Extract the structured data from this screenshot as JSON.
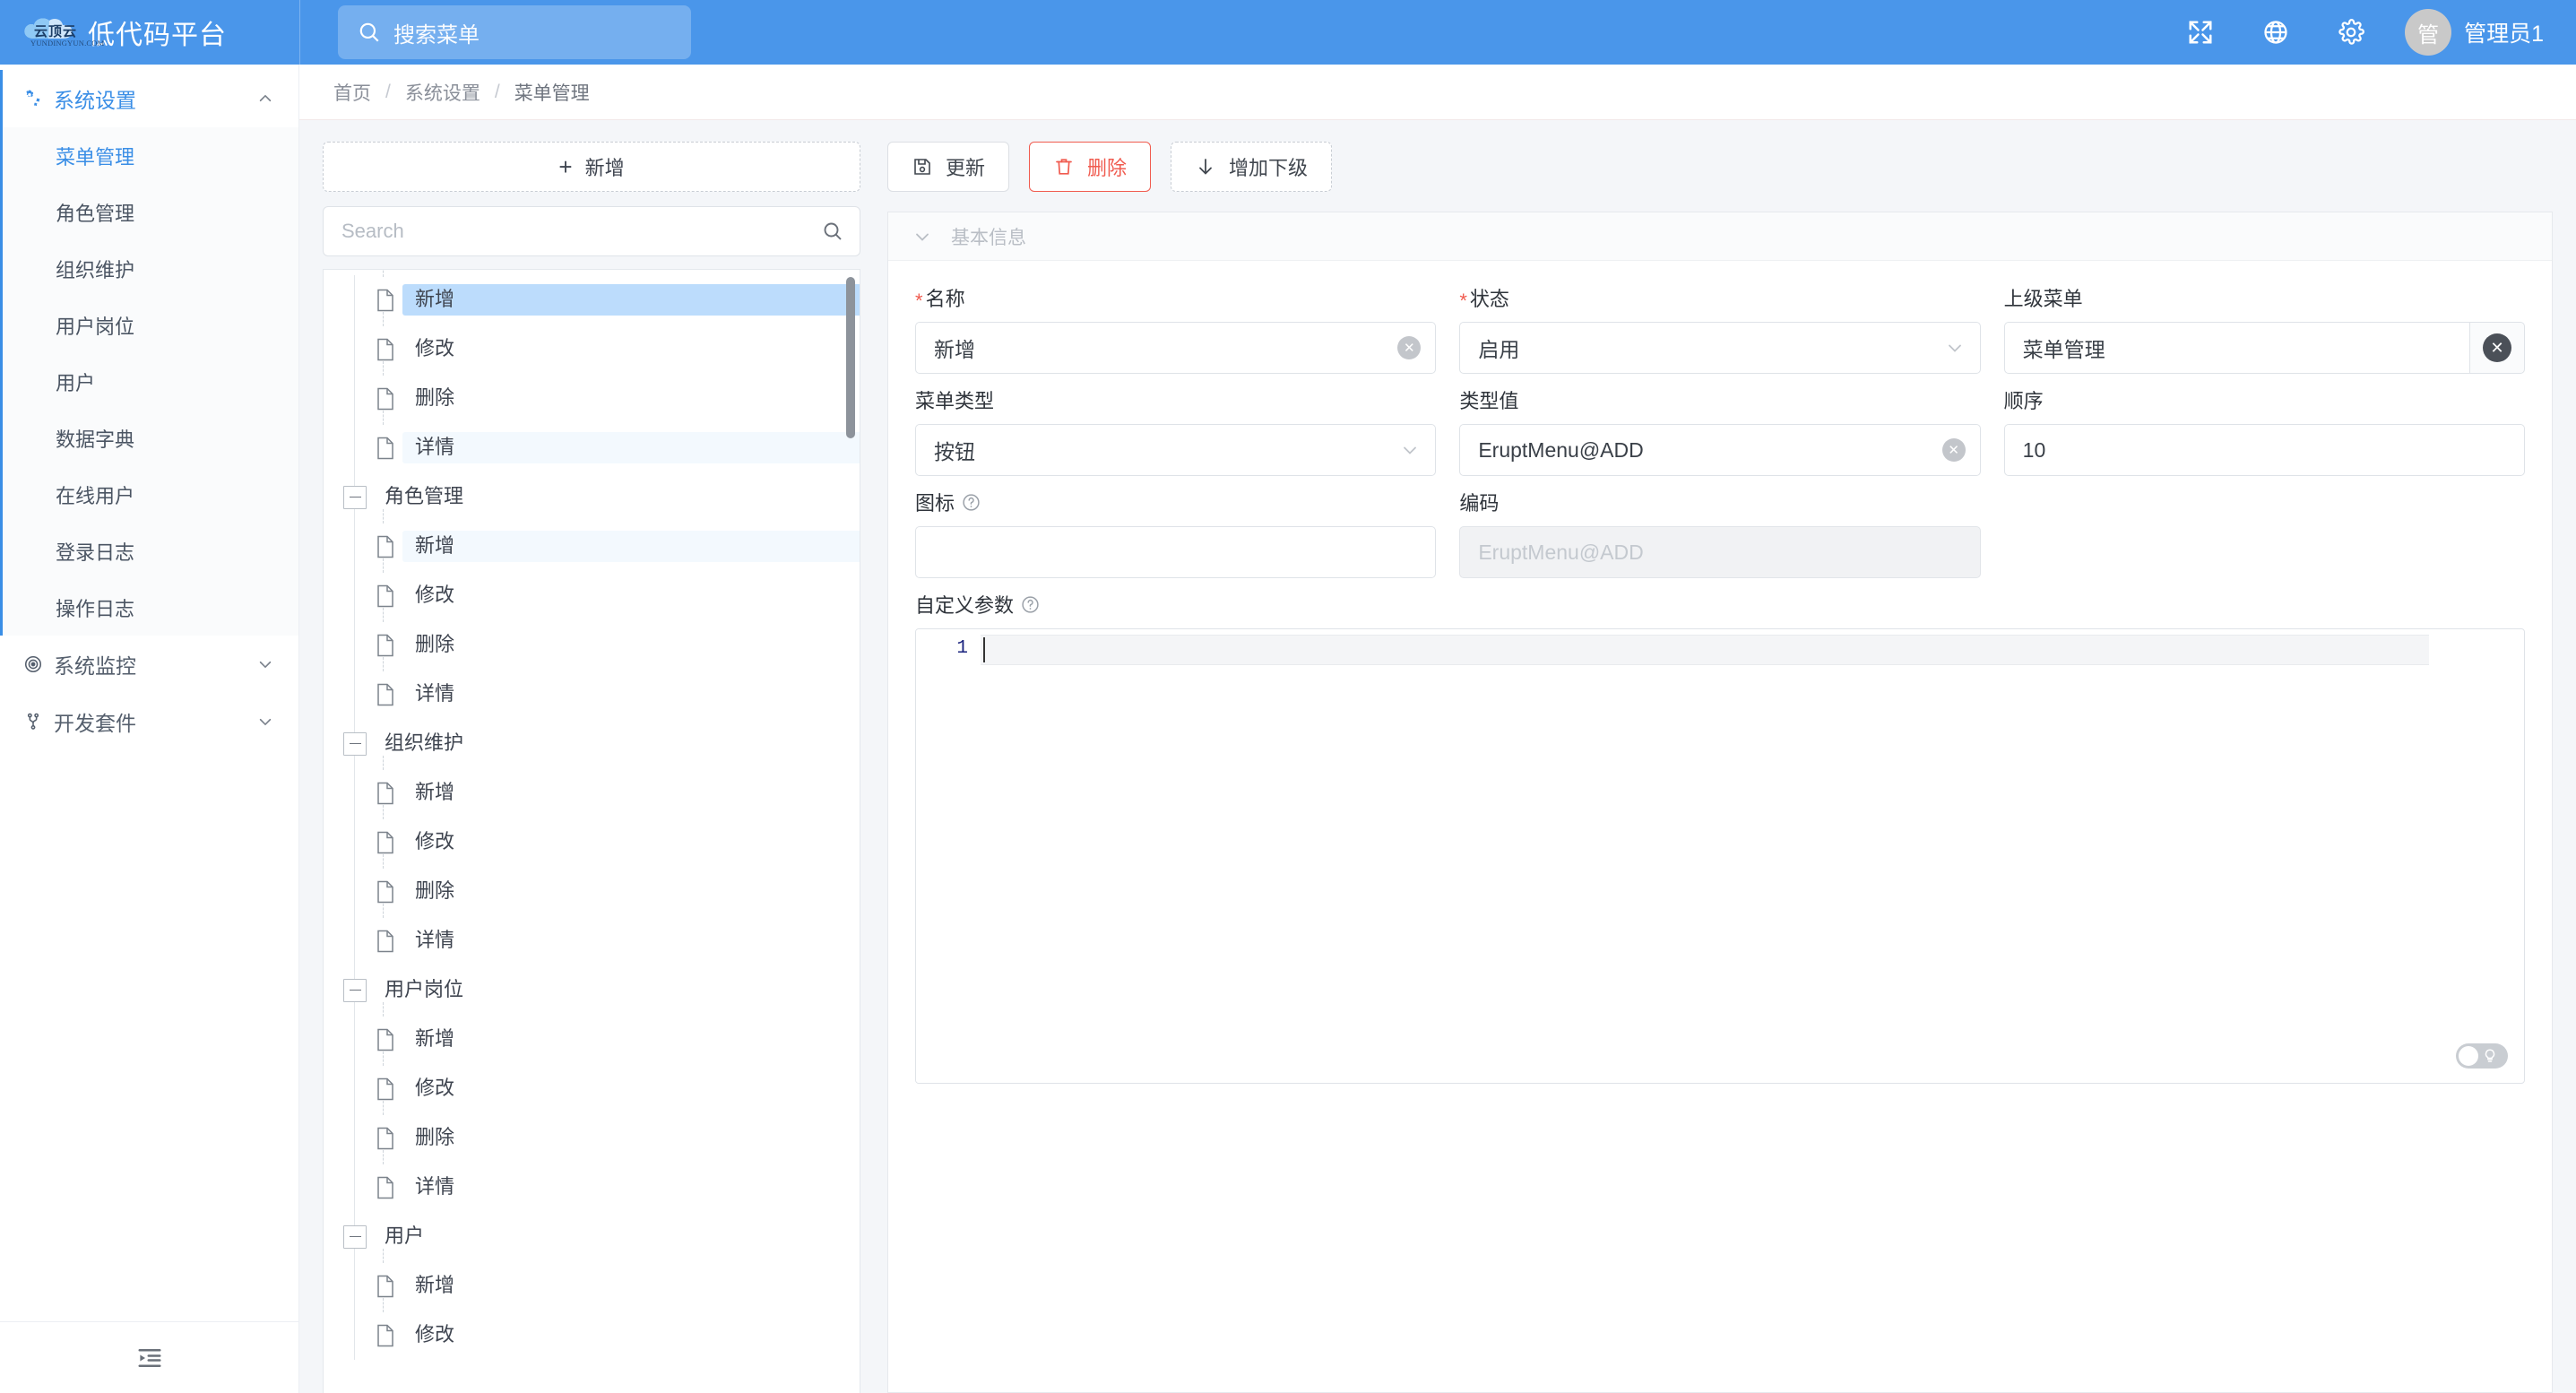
{
  "header": {
    "logo_text_cn": "云顶云",
    "logo_text_en": "YUNDINGYUN.COM",
    "brand_title": "低代码平台",
    "search_placeholder": "搜索菜单",
    "icons": {
      "fullscreen": "fullscreen-icon",
      "language": "globe-icon",
      "settings": "gear-icon"
    },
    "avatar_text": "管",
    "username": "管理员1"
  },
  "sidebar": {
    "groups": [
      {
        "label": "系统设置",
        "icon": "settings-gears-icon",
        "expanded": true,
        "active": true,
        "items": [
          {
            "label": "菜单管理",
            "selected": true
          },
          {
            "label": "角色管理",
            "selected": false
          },
          {
            "label": "组织维护",
            "selected": false
          },
          {
            "label": "用户岗位",
            "selected": false
          },
          {
            "label": "用户",
            "selected": false
          },
          {
            "label": "数据字典",
            "selected": false
          },
          {
            "label": "在线用户",
            "selected": false
          },
          {
            "label": "登录日志",
            "selected": false
          },
          {
            "label": "操作日志",
            "selected": false
          }
        ]
      },
      {
        "label": "系统监控",
        "icon": "target-icon",
        "expanded": false,
        "active": false,
        "items": []
      },
      {
        "label": "开发套件",
        "icon": "branch-icon",
        "expanded": false,
        "active": false,
        "items": []
      }
    ],
    "fold_icon": "menu-fold-icon"
  },
  "breadcrumb": {
    "items": [
      "首页",
      "系统设置",
      "菜单管理"
    ],
    "separator": "/"
  },
  "tree_panel": {
    "add_label": "新增",
    "search_placeholder": "Search",
    "nodes": [
      {
        "type": "leaf",
        "label": "新增",
        "state": "selected"
      },
      {
        "type": "leaf",
        "label": "修改",
        "state": "none"
      },
      {
        "type": "leaf",
        "label": "删除",
        "state": "none"
      },
      {
        "type": "leaf",
        "label": "详情",
        "state": "soft"
      },
      {
        "type": "branch",
        "label": "角色管理",
        "state": "none"
      },
      {
        "type": "leaf",
        "label": "新增",
        "state": "soft"
      },
      {
        "type": "leaf",
        "label": "修改",
        "state": "none"
      },
      {
        "type": "leaf",
        "label": "删除",
        "state": "none"
      },
      {
        "type": "leaf",
        "label": "详情",
        "state": "none"
      },
      {
        "type": "branch",
        "label": "组织维护",
        "state": "none"
      },
      {
        "type": "leaf",
        "label": "新增",
        "state": "none"
      },
      {
        "type": "leaf",
        "label": "修改",
        "state": "none"
      },
      {
        "type": "leaf",
        "label": "删除",
        "state": "none"
      },
      {
        "type": "leaf",
        "label": "详情",
        "state": "none"
      },
      {
        "type": "branch",
        "label": "用户岗位",
        "state": "none"
      },
      {
        "type": "leaf",
        "label": "新增",
        "state": "none"
      },
      {
        "type": "leaf",
        "label": "修改",
        "state": "none"
      },
      {
        "type": "leaf",
        "label": "删除",
        "state": "none"
      },
      {
        "type": "leaf",
        "label": "详情",
        "state": "none"
      },
      {
        "type": "branch",
        "label": "用户",
        "state": "none"
      },
      {
        "type": "leaf",
        "label": "新增",
        "state": "none"
      },
      {
        "type": "leaf",
        "label": "修改",
        "state": "none"
      }
    ]
  },
  "toolbar": {
    "update_label": "更新",
    "delete_label": "删除",
    "add_child_label": "增加下级"
  },
  "form": {
    "section_title": "基本信息",
    "name": {
      "label": "名称",
      "required": true,
      "value": "新增"
    },
    "status": {
      "label": "状态",
      "required": true,
      "value": "启用"
    },
    "parent_menu": {
      "label": "上级菜单",
      "required": false,
      "value": "菜单管理"
    },
    "menu_type": {
      "label": "菜单类型",
      "required": false,
      "value": "按钮"
    },
    "type_value": {
      "label": "类型值",
      "required": false,
      "value": "EruptMenu@ADD"
    },
    "order": {
      "label": "顺序",
      "required": false,
      "value": "10"
    },
    "icon_field": {
      "label": "图标",
      "required": false,
      "value": "",
      "has_help": true
    },
    "code": {
      "label": "编码",
      "required": false,
      "value": "",
      "placeholder": "EruptMenu@ADD",
      "disabled": true
    },
    "custom_params": {
      "label": "自定义参数",
      "has_help": true,
      "line_number": "1",
      "value": ""
    }
  },
  "colors": {
    "header_blue": "#4a96ea",
    "accent_blue": "#3a8ee6",
    "danger_red": "#f05b4f",
    "tree_selected": "#bcdcfc",
    "tree_soft": "#f3f9fe",
    "page_bg": "#f4f6f9"
  }
}
